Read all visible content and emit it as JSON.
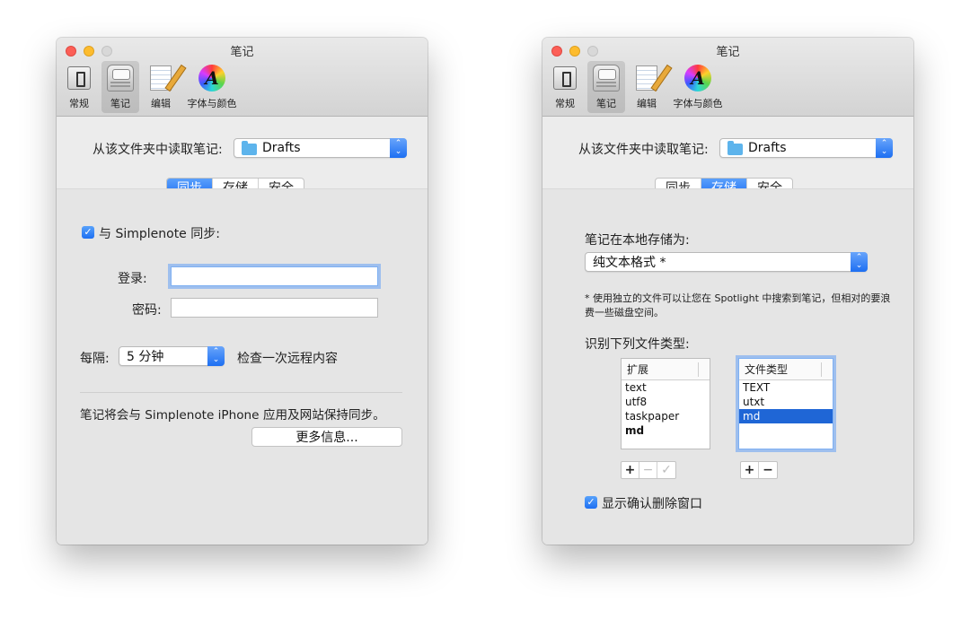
{
  "left": {
    "title": "笔记",
    "toolbar": [
      {
        "label": "常规",
        "icon": "general-icon"
      },
      {
        "label": "笔记",
        "icon": "notes-icon",
        "selected": true
      },
      {
        "label": "编辑",
        "icon": "edit-icon"
      },
      {
        "label": "字体与颜色",
        "icon": "font-color-icon"
      }
    ],
    "folder_label": "从该文件夹中读取笔记:",
    "folder_value": "Drafts",
    "tabs": [
      "同步",
      "存储",
      "安全"
    ],
    "active_tab": "同步",
    "sync_checkbox_label": "与 Simplenote 同步:",
    "sync_checked": true,
    "login_label": "登录:",
    "login_value": "",
    "password_label": "密码:",
    "password_value": "",
    "interval_label": "每隔:",
    "interval_value": "5 分钟",
    "interval_suffix": "检查一次远程内容",
    "info_text": "笔记将会与 Simplenote iPhone 应用及网站保持同步。",
    "more_button": "更多信息..."
  },
  "right": {
    "title": "笔记",
    "toolbar": [
      {
        "label": "常规",
        "icon": "general-icon"
      },
      {
        "label": "笔记",
        "icon": "notes-icon",
        "selected": true
      },
      {
        "label": "编辑",
        "icon": "edit-icon"
      },
      {
        "label": "字体与颜色",
        "icon": "font-color-icon"
      }
    ],
    "folder_label": "从该文件夹中读取笔记:",
    "folder_value": "Drafts",
    "tabs": [
      "同步",
      "存储",
      "安全"
    ],
    "active_tab": "存储",
    "storage_label": "笔记在本地存储为:",
    "storage_value": "纯文本格式 *",
    "footnote": "* 使用独立的文件可以让您在 Spotlight 中搜索到笔记，但相对的要浪费一些磁盘空间。",
    "filetypes_label": "识别下列文件类型:",
    "ext_header": "扩展",
    "extensions": [
      "text",
      "utf8",
      "taskpaper",
      "md"
    ],
    "bold_extension": "md",
    "type_header": "文件类型",
    "types": [
      "TEXT",
      "utxt",
      "md"
    ],
    "selected_type": "md",
    "confirm_delete_label": "显示确认删除窗口",
    "confirm_delete_checked": true
  },
  "icons": {
    "checkmark": "✓",
    "popup_arrows": "⌃⌄",
    "plus": "+",
    "minus": "−"
  }
}
